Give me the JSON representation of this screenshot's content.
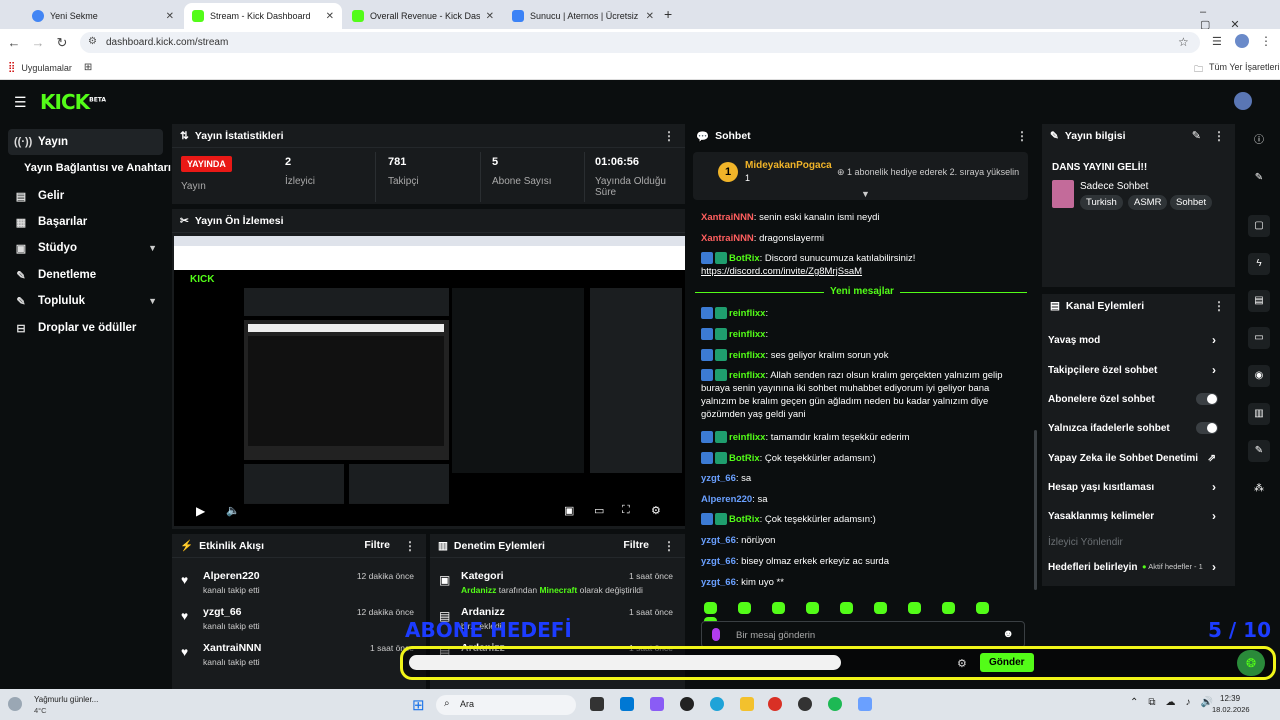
{
  "browser": {
    "tabs": [
      {
        "label": "Yeni Sekme",
        "color": "#4285f4"
      },
      {
        "label": "Stream - Kick Dashboard",
        "color": "#53fc18"
      },
      {
        "label": "Overall Revenue - Kick Dashbo",
        "color": "#53fc18"
      },
      {
        "label": "Sunucu | Aternos | Ücretsiz Min",
        "color": "#3b82f6"
      }
    ],
    "url": "dashboard.kick.com/stream",
    "bookmarks": {
      "apps": "Uygulamalar",
      "all": "Tüm Yer İşaretleri"
    }
  },
  "brand": {
    "logo": "KICK",
    "beta": "BETA",
    "accent": "#53fc18"
  },
  "sidebar": {
    "items": [
      {
        "label": "Yayın",
        "icon": "broadcast-icon"
      },
      {
        "label": "Yayın Bağlantısı ve Anahtarı",
        "icon": ""
      },
      {
        "label": "Gelir",
        "icon": "chart-icon"
      },
      {
        "label": "Başarılar",
        "icon": "trophy-icon"
      },
      {
        "label": "Stüdyo",
        "icon": "studio-icon"
      },
      {
        "label": "Denetleme",
        "icon": "wrench-icon"
      },
      {
        "label": "Topluluk",
        "icon": "wrench-icon"
      },
      {
        "label": "Droplar ve ödüller",
        "icon": "gift-icon"
      }
    ]
  },
  "stats": {
    "title": "Yayın İstatistikleri",
    "live_badge": "YAYINDA",
    "live_label": "Yayın",
    "viewers": {
      "value": "2",
      "label": "İzleyici"
    },
    "followers": {
      "value": "781",
      "label": "Takipçi"
    },
    "subs": {
      "value": "5",
      "label": "Abone Sayısı"
    },
    "uptime": {
      "value": "01:06:56",
      "label": "Yayında Olduğu Süre"
    }
  },
  "preview": {
    "title": "Yayın Ön İzlemesi"
  },
  "activity": {
    "title": "Etkinlik Akışı",
    "filter": "Filtre",
    "items": [
      {
        "name": "Alperen220",
        "sub": "kanalı takip etti",
        "time": "12 dakika önce"
      },
      {
        "name": "yzgt_66",
        "sub": "kanalı takip etti",
        "time": "12 dakika önce"
      },
      {
        "name": "XantraiNNN",
        "sub": "kanalı takip etti",
        "time": "1 saat önce"
      }
    ]
  },
  "modlog": {
    "title": "Denetim Eylemleri",
    "filter": "Filtre",
    "items": [
      {
        "name": "Kategori",
        "user": "Ardanizz",
        "middle": " tarafından ",
        "cat": "Minecraft",
        "rest": " olarak değiştirildi",
        "time": "1 saat önce"
      },
      {
        "name": "Ardanizz",
        "sub": "bir... ekledi",
        "time": "1 saat önce"
      },
      {
        "name": "Ardanizz",
        "sub": "",
        "time": "1 saat önce"
      }
    ]
  },
  "chat": {
    "title": "Sohbet",
    "gift": {
      "user": "MideyakanPogaca",
      "count": "1",
      "note": "1 abonelik hediye ederek 2. sıraya yükselin"
    },
    "new_messages": "Yeni mesajlar",
    "messages": [
      {
        "user": "XantraiNNN",
        "text": ": senin eski kanalın ismi neydi",
        "color": "#ff5f5f"
      },
      {
        "user": "XantraiNNN",
        "text": ": dragonslayermi",
        "color": "#ff5f5f"
      },
      {
        "user": "BotRix",
        "text": ": Discord sunucumuza katılabilirsiniz!",
        "link": "https://discord.com/invite/Zg8MrjSsaM",
        "color": "#53fc18"
      },
      {
        "user": "reinflixx",
        "text": ":",
        "color": "#53fc18"
      },
      {
        "user": "reinflixx",
        "text": ":",
        "color": "#53fc18"
      },
      {
        "user": "reinflixx",
        "text": ": ses geliyor kralım sorun yok",
        "color": "#53fc18"
      },
      {
        "user": "reinflixx",
        "text": ": Allah senden razı olsun kralım gerçekten yalnızım gelip buraya senin yayınına iki sohbet muhabbet ediyorum iyi geliyor bana yalnızım be kralım geçen gün ağladım neden bu kadar yalnızım diye gözümden yaş geldi yani",
        "color": "#53fc18"
      },
      {
        "user": "reinflixx",
        "text": ": tamamdır kralım teşekkür ederim",
        "color": "#53fc18"
      },
      {
        "user": "BotRix",
        "text": ": Çok teşekkürler adamsın:)",
        "color": "#53fc18"
      },
      {
        "user": "yzgt_66",
        "text": ": sa",
        "color": "#6aa0ff"
      },
      {
        "user": "Alperen220",
        "text": ": sa",
        "color": "#6aa0ff"
      },
      {
        "user": "BotRix",
        "text": ": Çok teşekkürler adamsın:)",
        "color": "#53fc18"
      },
      {
        "user": "yzgt_66",
        "text": ": nörüyon",
        "color": "#6aa0ff"
      },
      {
        "user": "yzgt_66",
        "text": ": bisey olmaz erkek erkeyiz ac surda",
        "color": "#6aa0ff"
      },
      {
        "user": "yzgt_66",
        "text": ": kim uyo **",
        "color": "#6aa0ff"
      }
    ],
    "input_placeholder": "Bir mesaj gönderin",
    "send": "Gönder"
  },
  "info": {
    "title": "Yayın bilgisi",
    "stream_title": "DANS YAYINI GELİ!!",
    "category": "Sadece Sohbet",
    "tags": [
      "Turkish",
      "ASMR",
      "Sohbet"
    ]
  },
  "channel_actions": {
    "title": "Kanal Eylemleri",
    "items": [
      {
        "label": "Yavaş mod",
        "kind": "arrow"
      },
      {
        "label": "Takipçilere özel sohbet",
        "kind": "arrow"
      },
      {
        "label": "Abonelere özel sohbet",
        "kind": "toggle"
      },
      {
        "label": "Yalnızca ifadelerle sohbet",
        "kind": "toggle"
      },
      {
        "label": "Yapay Zeka ile Sohbet Denetimi",
        "kind": "ext"
      },
      {
        "label": "Hesap yaşı kısıtlaması",
        "kind": "arrow"
      },
      {
        "label": "Yasaklanmış kelimeler",
        "kind": "arrow"
      },
      {
        "label": "İzleyici Yönlendir",
        "kind": "disabled"
      },
      {
        "label": "Hedefleri belirleyin",
        "kind": "goal"
      }
    ],
    "goal_status": "Aktif hedefler - 1"
  },
  "overlay": {
    "sub_goal": "ABONE HEDEFİ",
    "goal_count": "5 / 10",
    "accent": "#f1f519"
  },
  "taskbar": {
    "weather": "Yağmurlu günler...",
    "temp": "4°C",
    "search": "Ara",
    "time": "12:39",
    "date": "18.02.2026"
  }
}
